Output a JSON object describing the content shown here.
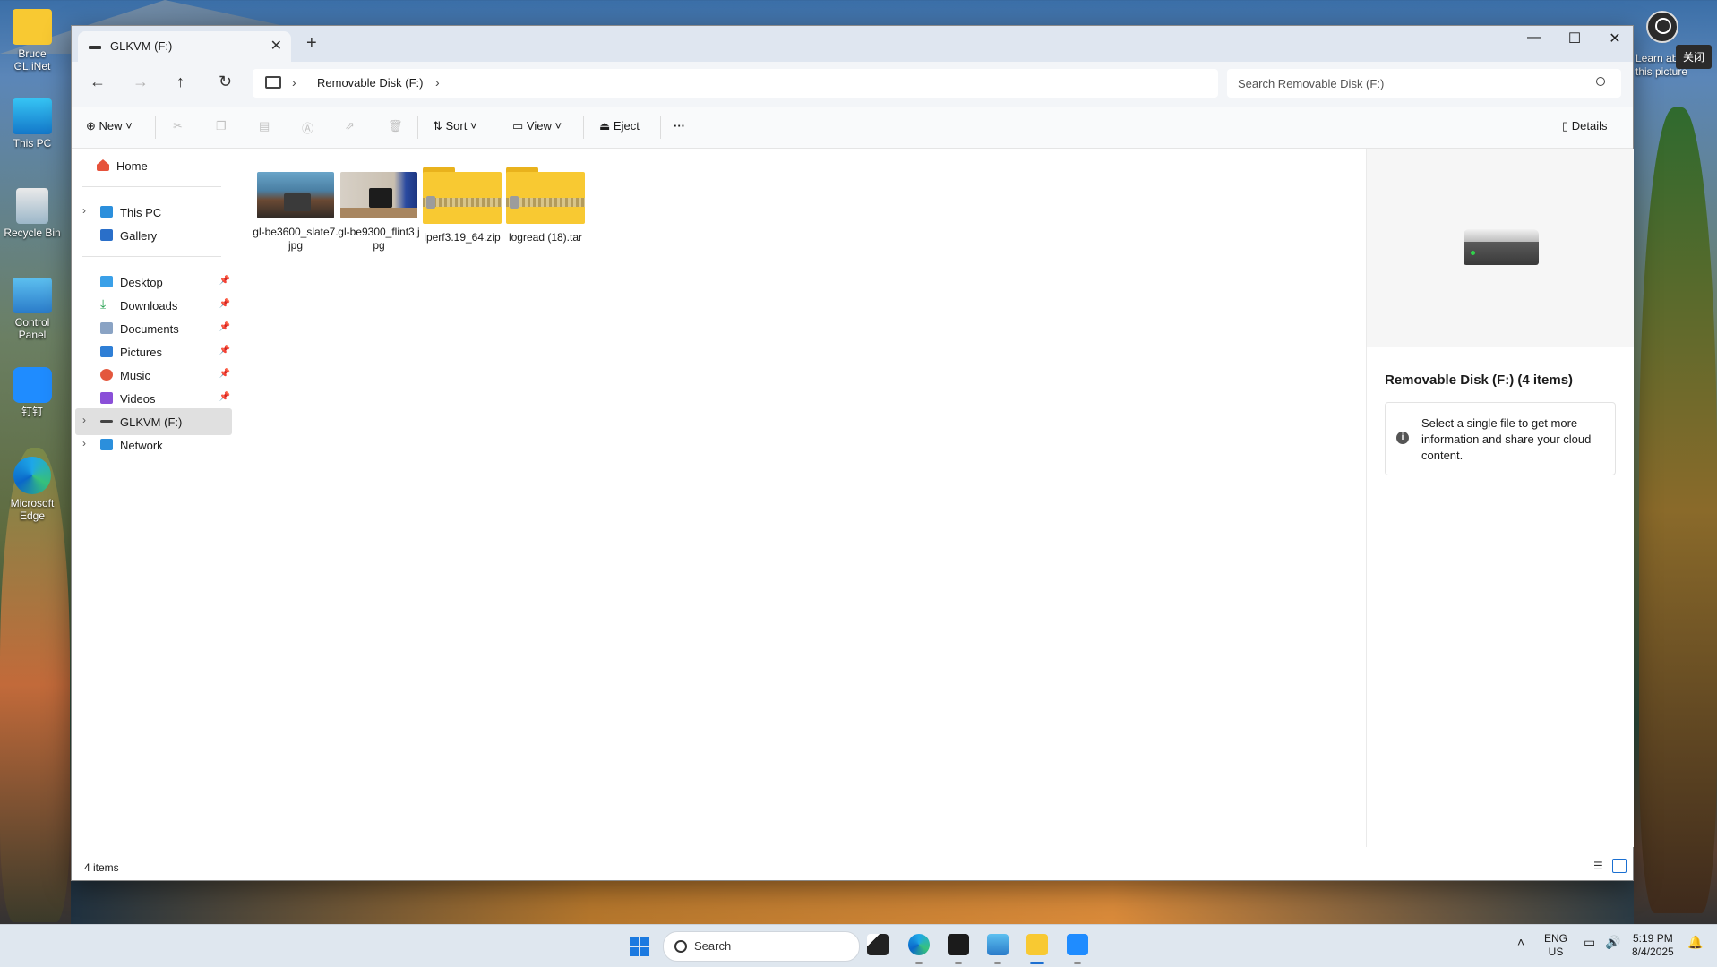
{
  "desktop": {
    "icons": [
      {
        "label": "Bruce GL.iNet"
      },
      {
        "label": "This PC"
      },
      {
        "label": "Recycle Bin"
      },
      {
        "label": "Control Panel"
      },
      {
        "label": "钉钉"
      },
      {
        "label": "Microsoft Edge"
      }
    ],
    "learn_label": "Learn about this picture",
    "close_tooltip": "关闭"
  },
  "window": {
    "tab_title": "GLKVM (F:)",
    "breadcrumb_location": "Removable Disk (F:)",
    "search_placeholder": "Search Removable Disk (F:)",
    "toolbar": {
      "new_label": "New",
      "sort_label": "Sort",
      "view_label": "View",
      "eject_label": "Eject",
      "more_label": "···",
      "details_label": "Details"
    },
    "nav": {
      "home": "Home",
      "this_pc": "This PC",
      "gallery": "Gallery",
      "desktop": "Desktop",
      "downloads": "Downloads",
      "documents": "Documents",
      "pictures": "Pictures",
      "music": "Music",
      "videos": "Videos",
      "drive": "GLKVM (F:)",
      "network": "Network"
    },
    "files": [
      {
        "name": "gl-be3600_slate7.jpg",
        "type": "image"
      },
      {
        "name": "gl-be9300_flint3.jpg",
        "type": "image"
      },
      {
        "name": "iperf3.19_64.zip",
        "type": "zip"
      },
      {
        "name": "logread (18).tar",
        "type": "zip"
      }
    ],
    "details": {
      "heading": "Removable Disk (F:) (4 items)",
      "message": "Select a single file to get more information and share your cloud content."
    },
    "status": {
      "count": "4 items"
    }
  },
  "taskbar": {
    "search_label": "Search",
    "lang_line1": "ENG",
    "lang_line2": "US",
    "time": "5:19 PM",
    "date": "8/4/2025"
  }
}
